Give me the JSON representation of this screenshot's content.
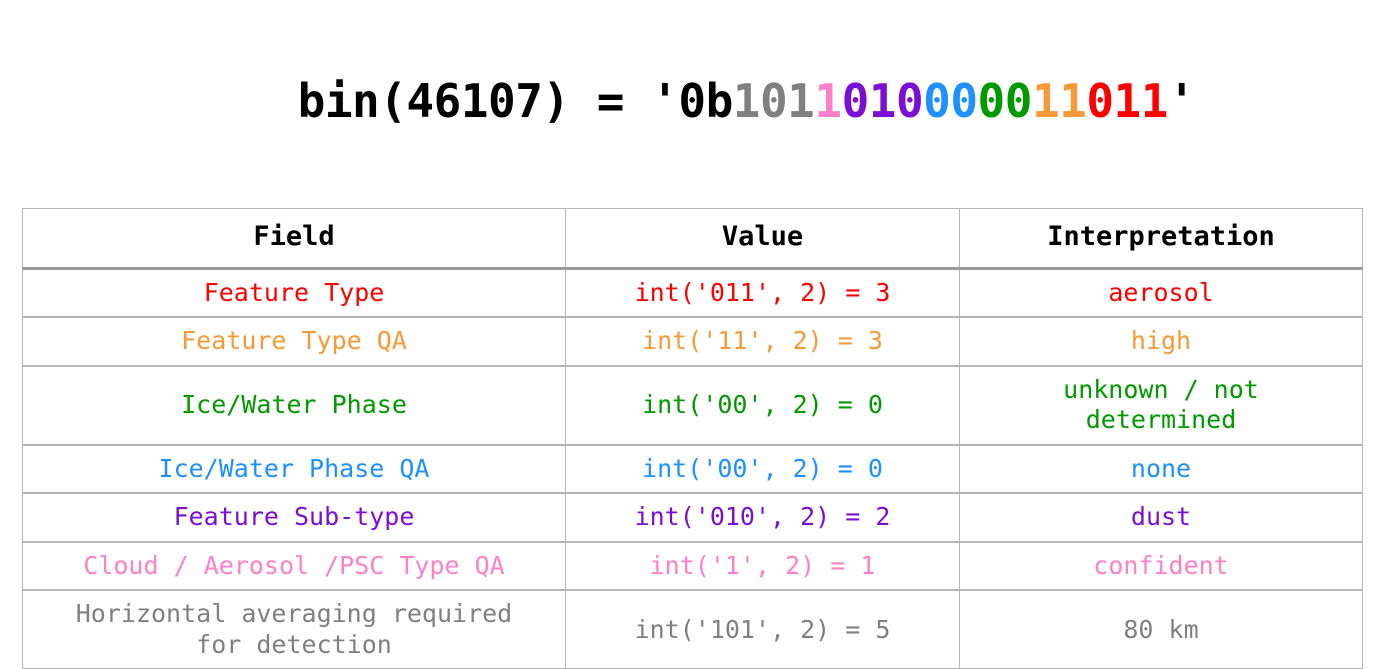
{
  "title": {
    "prefix": "bin(46107) = '0b",
    "suffix": "'",
    "segments": [
      {
        "bits": "101",
        "color": "#808080",
        "name": "horizontal-averaging"
      },
      {
        "bits": "1",
        "color": "#FF80C8",
        "name": "cloud-aerosol-psc-type-qa"
      },
      {
        "bits": "010",
        "color": "#7B0FD4",
        "name": "feature-sub-type"
      },
      {
        "bits": "00",
        "color": "#1E90FF",
        "name": "ice-water-phase-qa"
      },
      {
        "bits": "00",
        "color": "#009900",
        "name": "ice-water-phase"
      },
      {
        "bits": "11",
        "color": "#F89939",
        "name": "feature-type-qa"
      },
      {
        "bits": "011",
        "color": "#FF0000",
        "name": "feature-type"
      }
    ]
  },
  "table": {
    "headers": [
      "Field",
      "Value",
      "Interpretation"
    ],
    "rows": [
      {
        "field": "Feature Type",
        "value": "int('011', 2) = 3",
        "interpretation": "aerosol",
        "color": "#FF0000",
        "tall": false
      },
      {
        "field": "Feature Type QA",
        "value": "int('11', 2) = 3",
        "interpretation": "high",
        "color": "#F89939",
        "tall": false
      },
      {
        "field": "Ice/Water Phase",
        "value": "int('00', 2) = 0",
        "interpretation": "unknown / not\ndetermined",
        "color": "#009900",
        "tall": true
      },
      {
        "field": "Ice/Water Phase QA",
        "value": "int('00', 2) = 0",
        "interpretation": "none",
        "color": "#1E90FF",
        "tall": false
      },
      {
        "field": "Feature Sub-type",
        "value": "int('010', 2) = 2",
        "interpretation": "dust",
        "color": "#7B0FD4",
        "tall": false
      },
      {
        "field": "Cloud / Aerosol /PSC Type QA",
        "value": "int('1', 2) = 1",
        "interpretation": "confident",
        "color": "#FF80C8",
        "tall": false
      },
      {
        "field": "Horizontal averaging required\nfor detection",
        "value": "int('101', 2) = 5",
        "interpretation": "80 km",
        "color": "#808080",
        "tall": true
      }
    ]
  }
}
